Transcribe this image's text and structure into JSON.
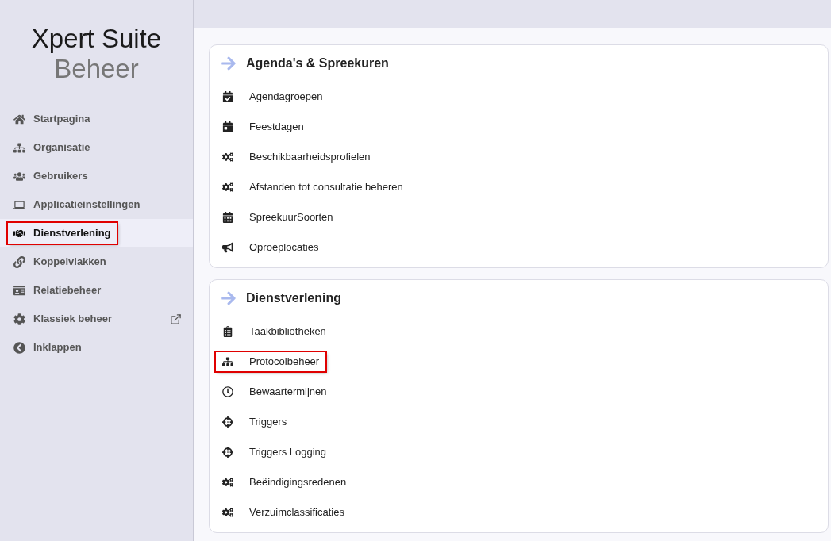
{
  "logo": {
    "line_1": "Xpert Suite",
    "line_2": "Beheer"
  },
  "sidebar": {
    "items": [
      {
        "label": "Startpagina",
        "selected": false,
        "highlighted": false,
        "external": false
      },
      {
        "label": "Organisatie",
        "selected": false,
        "highlighted": false,
        "external": false
      },
      {
        "label": "Gebruikers",
        "selected": false,
        "highlighted": false,
        "external": false
      },
      {
        "label": "Applicatieinstellingen",
        "selected": false,
        "highlighted": false,
        "external": false
      },
      {
        "label": "Dienstverlening",
        "selected": true,
        "highlighted": true,
        "external": false
      },
      {
        "label": "Koppelvlakken",
        "selected": false,
        "highlighted": false,
        "external": false
      },
      {
        "label": "Relatiebeheer",
        "selected": false,
        "highlighted": false,
        "external": false
      },
      {
        "label": "Klassiek beheer",
        "selected": false,
        "highlighted": false,
        "external": true
      },
      {
        "label": "Inklappen",
        "selected": false,
        "highlighted": false,
        "external": false
      }
    ]
  },
  "sections": [
    {
      "title": "Agenda's & Spreekuren",
      "items": [
        {
          "label": "Agendagroepen",
          "highlighted": false
        },
        {
          "label": "Feestdagen",
          "highlighted": false
        },
        {
          "label": "Beschikbaarheidsprofielen",
          "highlighted": false
        },
        {
          "label": "Afstanden tot consultatie beheren",
          "highlighted": false
        },
        {
          "label": "SpreekuurSoorten",
          "highlighted": false
        },
        {
          "label": "Oproeplocaties",
          "highlighted": false
        }
      ]
    },
    {
      "title": "Dienstverlening",
      "items": [
        {
          "label": "Taakbibliotheken",
          "highlighted": false
        },
        {
          "label": "Protocolbeheer",
          "highlighted": true
        },
        {
          "label": "Bewaartermijnen",
          "highlighted": false
        },
        {
          "label": "Triggers",
          "highlighted": false
        },
        {
          "label": "Triggers Logging",
          "highlighted": false
        },
        {
          "label": "Beëindigingsredenen",
          "highlighted": false
        },
        {
          "label": "Verzuimclassificaties",
          "highlighted": false
        }
      ]
    }
  ]
}
